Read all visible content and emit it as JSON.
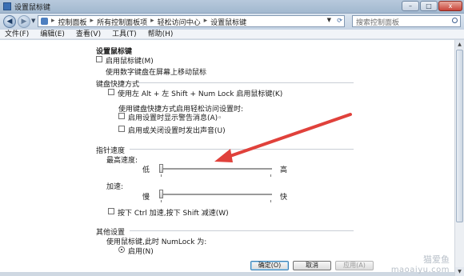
{
  "window": {
    "title": "设置鼠标键",
    "minimize": "–",
    "maximize": "□",
    "close": "x"
  },
  "address": {
    "back": "◀",
    "forward": "▶",
    "crumbs": [
      "控制面板",
      "所有控制面板项",
      "轻松访问中心",
      "设置鼠标键"
    ],
    "sep": "▸",
    "search_placeholder": "搜索控制面板"
  },
  "menu": [
    "文件(F)",
    "编辑(E)",
    "查看(V)",
    "工具(T)",
    "帮助(H)"
  ],
  "page": {
    "title": "设置鼠标键",
    "enable_label": "启用鼠标键(M)",
    "enable_desc": "使用数字键盘在屏幕上移动鼠标",
    "shortcut_section": "键盘快捷方式",
    "shortcut_label": "使用左 Alt + 左 Shift + Num Lock 启用鼠标键(K)",
    "shortcut_sub_desc": "使用键盘快捷方式启用轻松访问设置时:",
    "warning_label": "启用设置时显示警告消息(A)◦",
    "sound_label": "启用或关闭设置时发出声音(U)",
    "speed_section": "指针速度",
    "top_speed_label": "最高速度:",
    "slow": "低",
    "fast": "高",
    "accel_label": "加速:",
    "accel_slow": "慢",
    "accel_fast": "快",
    "ctrl_shift_label": "按下 Ctrl 加速,按下 Shift 减速(W)",
    "other_section": "其他设置",
    "numlock_desc": "使用鼠标键,此时 NumLock 为:",
    "on_label": "启用(N)",
    "top_speed_value": 0.0,
    "accel_value": 0.0
  },
  "buttons": {
    "ok": "确定(O)",
    "cancel": "取消",
    "apply": "应用(A)"
  },
  "watermark": {
    "line1": "猫爱鱼",
    "line2": "maoaiyu.com"
  },
  "colors": {
    "arrow": "#e0413b",
    "window_bg": "#cfd8e2"
  }
}
